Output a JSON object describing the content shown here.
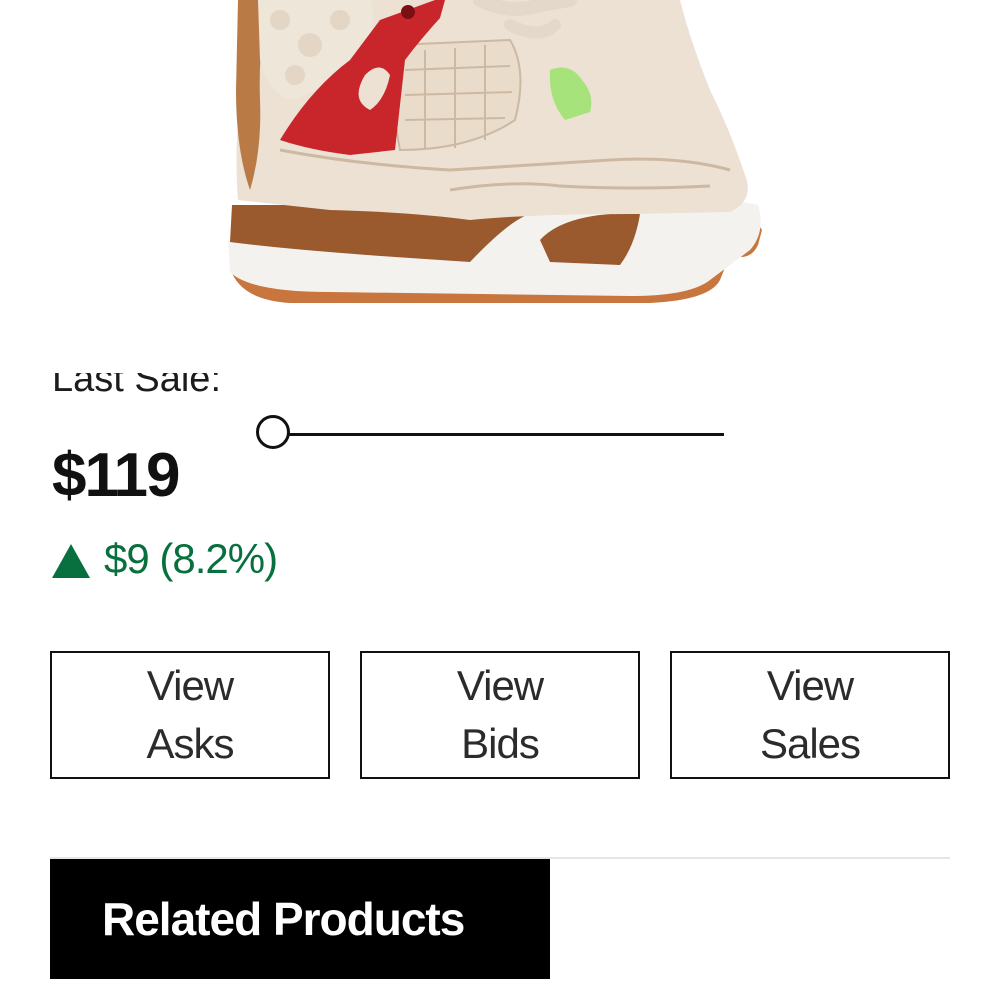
{
  "product": {
    "image_alt": "sneaker-image"
  },
  "last_sale": {
    "label": "Last Sale:",
    "price": "$119",
    "change": "$9 (8.2%)",
    "change_direction": "up",
    "change_color": "#08703f"
  },
  "buttons": [
    {
      "line1": "View",
      "line2": "Asks"
    },
    {
      "line1": "View",
      "line2": "Bids"
    },
    {
      "line1": "View",
      "line2": "Sales"
    }
  ],
  "related": {
    "title": "Related Products"
  }
}
